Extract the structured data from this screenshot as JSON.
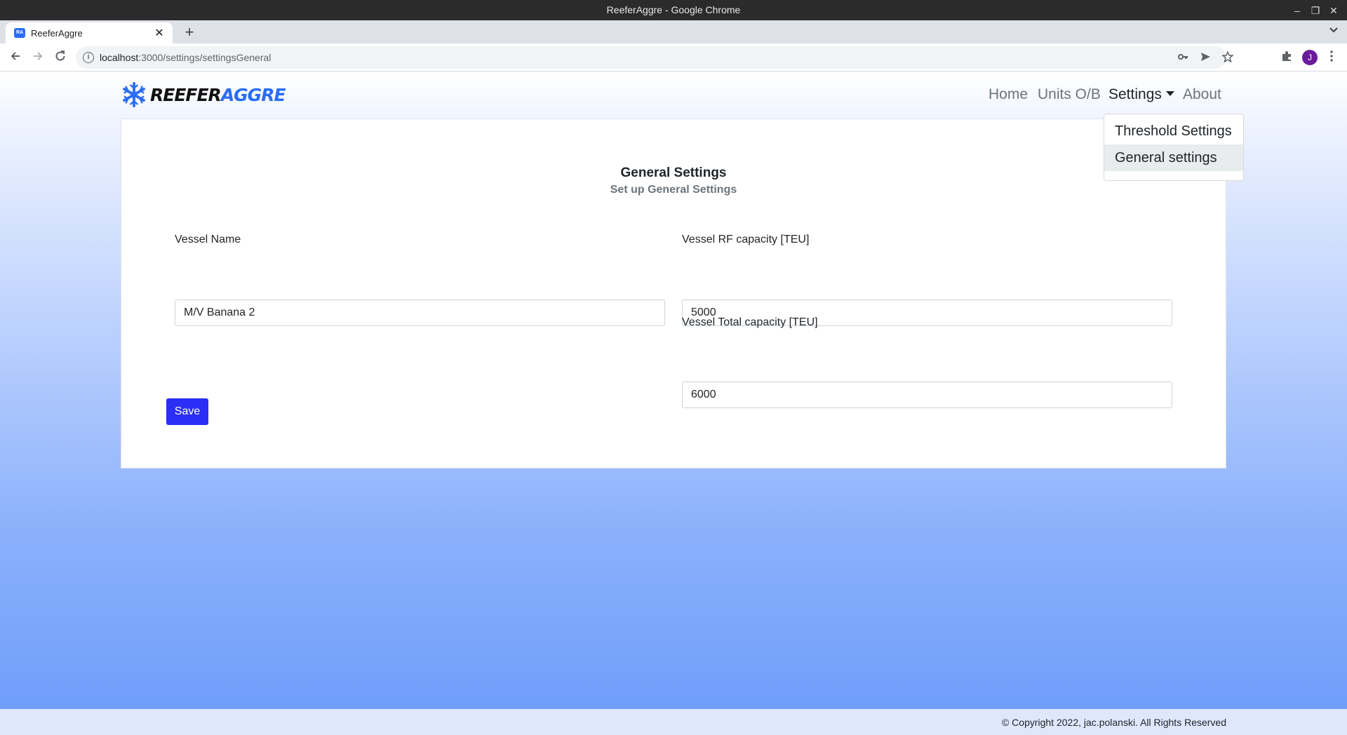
{
  "window": {
    "title": "ReeferAggre - Google Chrome",
    "minimize_glyph": "–",
    "restore_glyph": "❐",
    "close_glyph": "✕"
  },
  "tab": {
    "title": "ReeferAggre",
    "favicon_text": "RA",
    "close_glyph": "✕",
    "new_tab_glyph": "+"
  },
  "address_bar": {
    "host": "localhost",
    "path": ":3000/settings/settingsGeneral",
    "info_glyph": "i"
  },
  "app": {
    "brand": {
      "part1": "REEFER",
      "part2": "AGGRE"
    },
    "nav": {
      "home": "Home",
      "units": "Units O/B",
      "settings": "Settings",
      "about": "About"
    },
    "dropdown": {
      "items": [
        "Threshold Settings",
        "General settings"
      ],
      "active_index": 1
    },
    "form": {
      "title": "General Settings",
      "subtitle": "Set up General Settings",
      "vessel_name": {
        "label": "Vessel Name",
        "value": "M/V Banana 2"
      },
      "rf_capacity": {
        "label": "Vessel RF capacity [TEU]",
        "value": "5000"
      },
      "total_capacity": {
        "label": "Vessel Total capacity [TEU]",
        "value": "6000"
      },
      "save_label": "Save"
    },
    "footer": {
      "copyright": "© Copyright 2022, jac.polanski. All Rights Reserved"
    }
  },
  "colors": {
    "accent": "#2b2ef5",
    "brand_blue": "#2a6df4",
    "profile": "#6a1b9a"
  },
  "profile": {
    "initial": "J"
  }
}
